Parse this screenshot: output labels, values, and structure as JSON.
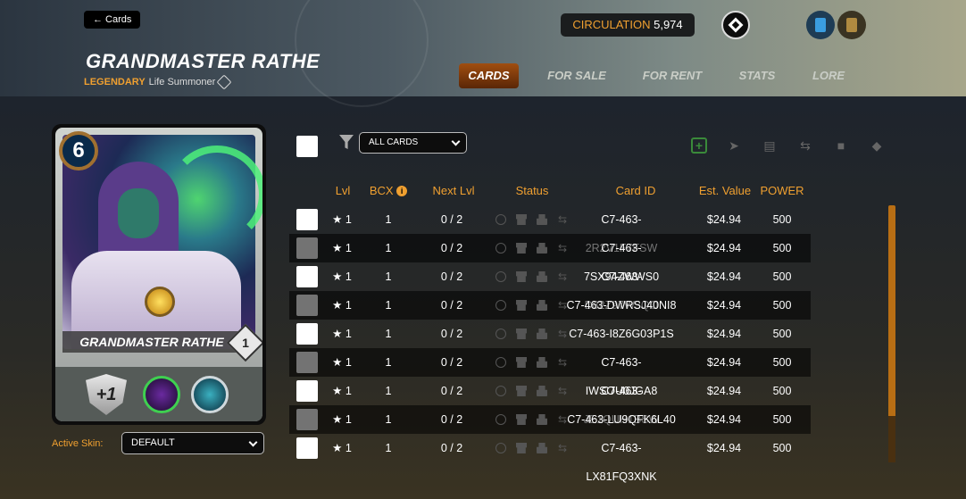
{
  "header": {
    "back_label": "← Cards",
    "card_name": "GRANDMASTER RATHE",
    "rarity": "LEGENDARY",
    "card_type": "Life Summoner",
    "circulation_label": "CIRCULATION",
    "circulation_value": "5,974"
  },
  "tabs": [
    {
      "label": "CARDS",
      "active": true
    },
    {
      "label": "FOR SALE",
      "active": false
    },
    {
      "label": "FOR RENT",
      "active": false
    },
    {
      "label": "STATS",
      "active": false
    },
    {
      "label": "LORE",
      "active": false
    }
  ],
  "card_preview": {
    "mana": "6",
    "name": "GRANDMASTER RATHE",
    "level": "1",
    "stat": "+1"
  },
  "skin": {
    "label": "Active Skin:",
    "value": "DEFAULT"
  },
  "filter": {
    "value": "ALL CARDS"
  },
  "table": {
    "headers": {
      "lvl": "Lvl",
      "bcx": "BCX",
      "bcx_info": "i",
      "next_lvl": "Next Lvl",
      "status": "Status",
      "card_id": "Card ID",
      "est_value": "Est. Value",
      "power": "POWER"
    },
    "rows": [
      {
        "lvl": "★ 1",
        "bcx": "1",
        "next": "0 / 2",
        "id": "C7-463-2R2V1F7FSW",
        "value": "$24.94",
        "power": "500"
      },
      {
        "lvl": "★ 1",
        "bcx": "1",
        "next": "0 / 2",
        "id": "C7-463-7SX94ZWWS0",
        "value": "$24.94",
        "power": "500"
      },
      {
        "lvl": "★ 1",
        "bcx": "1",
        "next": "0 / 2",
        "id": "C7-463-D82Z97W3QO",
        "value": "$24.94",
        "power": "500"
      },
      {
        "lvl": "★ 1",
        "bcx": "1",
        "next": "0 / 2",
        "id": "C7-463-DWRSJ40NI8",
        "value": "$24.94",
        "power": "500"
      },
      {
        "lvl": "★ 1",
        "bcx": "1",
        "next": "0 / 2",
        "id": "C7-463-I8Z6G03P1S",
        "value": "$24.94",
        "power": "500"
      },
      {
        "lvl": "★ 1",
        "bcx": "1",
        "next": "0 / 2",
        "id": "C7-463-IWSOU0JGA8",
        "value": "$24.94",
        "power": "500"
      },
      {
        "lvl": "★ 1",
        "bcx": "1",
        "next": "0 / 2",
        "id": "C7-463-JE1QUH1BSW",
        "value": "$24.94",
        "power": "500"
      },
      {
        "lvl": "★ 1",
        "bcx": "1",
        "next": "0 / 2",
        "id": "C7-463-LU9QFK6L40",
        "value": "$24.94",
        "power": "500"
      },
      {
        "lvl": "★ 1",
        "bcx": "1",
        "next": "0 / 2",
        "id": "C7-463-LX81FQ3XNK",
        "value": "$24.94",
        "power": "500"
      }
    ]
  },
  "colors": {
    "accent": "#f0a030",
    "active_tab": "#a04e10"
  }
}
